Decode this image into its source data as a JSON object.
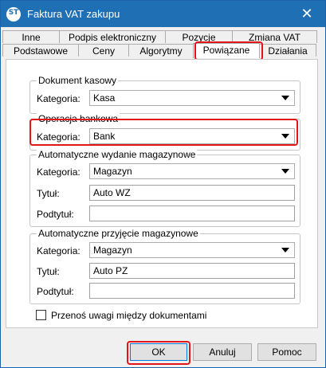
{
  "window": {
    "title": "Faktura VAT zakupu",
    "app_icon": "ST",
    "close_symbol": "✕"
  },
  "tabs": {
    "row1": [
      "Inne",
      "Podpis elektroniczny",
      "Pozycje",
      "Zmiana VAT"
    ],
    "row2": [
      "Podstawowe",
      "Ceny",
      "Algorytmy",
      "Powiązane",
      "Działania"
    ],
    "active": "Powiązane"
  },
  "groups": {
    "dokument_kasowy": {
      "title": "Dokument kasowy",
      "kategoria_label": "Kategoria:",
      "kategoria_value": "Kasa"
    },
    "operacja_bankowa": {
      "title": "Operacja bankowa",
      "kategoria_label": "Kategoria:",
      "kategoria_value": "Bank"
    },
    "wydanie": {
      "title": "Automatyczne wydanie magazynowe",
      "kategoria_label": "Kategoria:",
      "kategoria_value": "Magazyn",
      "tytul_label": "Tytuł:",
      "tytul_value": "Auto WZ",
      "podtytul_label": "Podtytuł:",
      "podtytul_value": ""
    },
    "przyjecie": {
      "title": "Automatyczne przyjęcie magazynowe",
      "kategoria_label": "Kategoria:",
      "kategoria_value": "Magazyn",
      "tytul_label": "Tytuł:",
      "tytul_value": "Auto PZ",
      "podtytul_label": "Podtytuł:",
      "podtytul_value": ""
    }
  },
  "checkbox": {
    "label": "Przenoś uwagi między dokumentami",
    "checked": false
  },
  "buttons": {
    "ok": "OK",
    "cancel": "Anuluj",
    "help": "Pomoc"
  },
  "colors": {
    "titlebar": "#1f6fb5",
    "highlight": "#e0161b"
  }
}
